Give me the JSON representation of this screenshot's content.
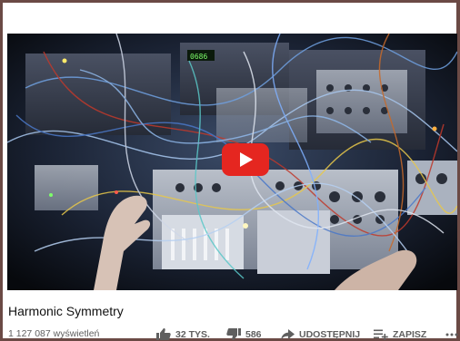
{
  "video": {
    "title": "Harmonic Symmetry",
    "views": "1 127 087 wyświetleń",
    "likes": "32 TYS.",
    "dislikes": "586",
    "share_label": "UDOSTĘPNIJ",
    "save_label": "ZAPISZ",
    "display_readout": "0686"
  },
  "colors": {
    "play_button": "#e52620",
    "background": "#ffffff",
    "frame_border": "#6b4a45"
  },
  "icons": [
    "play-icon",
    "thumbs-up-icon",
    "thumbs-down-icon",
    "share-arrow-icon",
    "playlist-add-icon",
    "more-icon"
  ]
}
